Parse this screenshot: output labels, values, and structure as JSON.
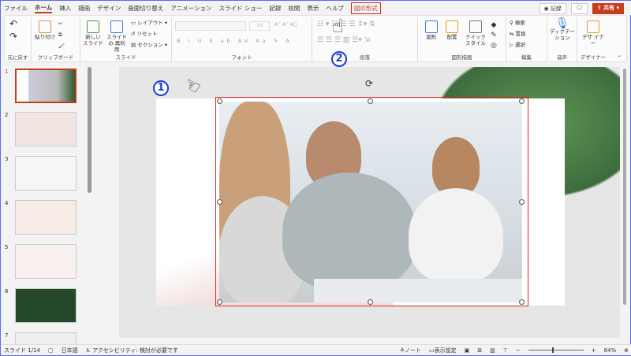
{
  "tabs": [
    "ファイル",
    "ホーム",
    "挿入",
    "描画",
    "デザイン",
    "画面切り替え",
    "アニメーション",
    "スライド ショー",
    "記録",
    "校閲",
    "表示",
    "ヘルプ",
    "図の形式"
  ],
  "record_label": "記録",
  "share_label": "共有",
  "ribbon": {
    "undo": {
      "label": "元に戻す"
    },
    "clipboard": {
      "label": "クリップボード",
      "paste": "貼り付け"
    },
    "slides": {
      "label": "スライド",
      "new_slide": "新しい スライド",
      "reuse": "スライドの 再利用",
      "layout": "レイアウト",
      "reset": "リセット",
      "section": "セクション"
    },
    "font": {
      "label": "フォント",
      "size": "18",
      "buttons": [
        "B",
        "I",
        "U",
        "S",
        "ab",
        "AV",
        "Aa",
        "A"
      ]
    },
    "paragraph": {
      "label": "段落"
    },
    "drawing": {
      "label": "図形描画",
      "shapes": "図形",
      "arrange": "配置",
      "quick_styles": "クイック スタイル"
    },
    "editing": {
      "label": "編集",
      "find": "検索",
      "replace": "置換",
      "select": "選択"
    },
    "voice": {
      "label": "音声",
      "dictate": "ディクテー ション"
    },
    "designer": {
      "label": "デザイナー",
      "btn": "デザ イナー"
    }
  },
  "thumbnails": [
    "1",
    "2",
    "3",
    "4",
    "5",
    "6",
    "7"
  ],
  "annotations": {
    "one": "1",
    "two": "2"
  },
  "status": {
    "slide": "スライド 1/14",
    "language": "日本語",
    "accessibility": "アクセシビリティ: 検討が必要です",
    "notes": "ノート",
    "display": "表示設定",
    "zoom": "84%"
  },
  "colors": {
    "accent": "#c43e1c",
    "annotation": "#1d3bd8",
    "selection": "#e02020"
  }
}
